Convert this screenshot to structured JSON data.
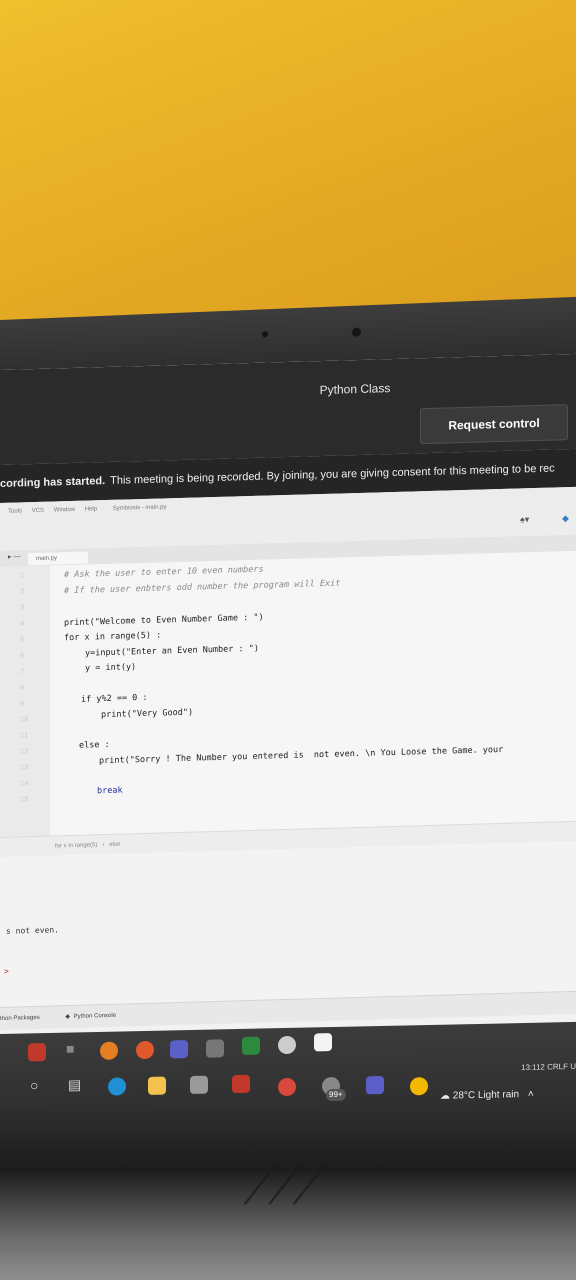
{
  "meeting": {
    "title": "Python Class",
    "request_control_label": "Request control",
    "banner_strong": "cording has started.",
    "banner_text": "This meeting is being recorded. By joining, you are giving consent for this meeting to be rec"
  },
  "ide": {
    "menu_items": [
      "Tools",
      "VCS",
      "Window",
      "Help"
    ],
    "project_title": "Symbiosis - main.py",
    "tab_label": "main.py",
    "line_numbers": [
      "1",
      "2",
      "3",
      "4",
      "5",
      "6",
      "7",
      "8",
      "9",
      "10",
      "11",
      "12",
      "13",
      "14",
      "15"
    ],
    "code": [
      {
        "text": "# Ask the user to enter 10 even numbers",
        "style": "comment"
      },
      {
        "text": "# If the user enbters odd number the program will Exit",
        "style": "comment"
      },
      {
        "text": "print(\"Welcome to Even Number Game : \")",
        "style": "normal"
      },
      {
        "text": "for x in range(5) :",
        "style": "normal"
      },
      {
        "text": "y=input(\"Enter an Even Number : \")",
        "style": "normal"
      },
      {
        "text": "y = int(y)",
        "style": "normal"
      },
      {
        "text": "if y%2 == 0 :",
        "style": "normal"
      },
      {
        "text": "print(\"Very Good\")",
        "style": "normal"
      },
      {
        "text": "else :",
        "style": "normal"
      },
      {
        "text": "print(\"Sorry ! The Number you entered is  not even. \\n You Loose the Game. your",
        "style": "normal"
      },
      {
        "text": "break",
        "style": "kw"
      }
    ],
    "breadcrumb": "for x in range(5)   ›   else",
    "console_output": "s not even.",
    "console_prompt": ">",
    "bottom_tabs": [
      "thon Packages",
      "Python Console"
    ]
  },
  "taskbar": {
    "status": "13:112   CRLF   U",
    "weather": "28°C  Light rain",
    "notification_badge": "99+"
  }
}
